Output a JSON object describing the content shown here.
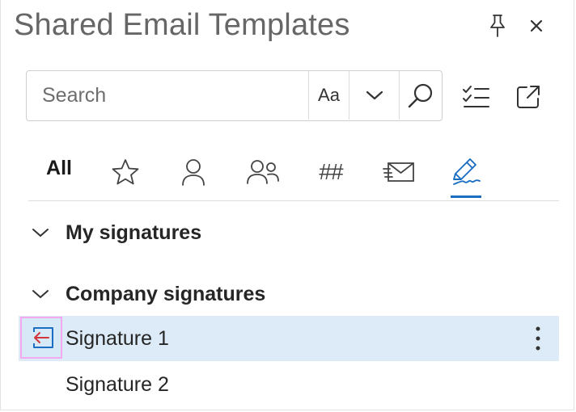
{
  "header": {
    "title": "Shared Email Templates",
    "pin_icon": "pin-icon",
    "close_icon": "close-icon"
  },
  "search": {
    "placeholder": "Search",
    "value": "",
    "match_case_label": "Aa",
    "dropdown_icon": "chevron-down-icon",
    "find_icon": "search-icon"
  },
  "toolbar": {
    "checklist_icon": "checklist-icon",
    "popout_icon": "popout-icon"
  },
  "tabs": [
    {
      "id": "all",
      "label": "All",
      "icon": "",
      "selected": false
    },
    {
      "id": "favorites",
      "label": "",
      "icon": "star-icon",
      "selected": false
    },
    {
      "id": "personal",
      "label": "",
      "icon": "person-icon",
      "selected": false
    },
    {
      "id": "team",
      "label": "",
      "icon": "people-icon",
      "selected": false
    },
    {
      "id": "macros",
      "label": "##",
      "icon": "",
      "selected": false
    },
    {
      "id": "email",
      "label": "",
      "icon": "email-icon",
      "selected": false
    },
    {
      "id": "signatures",
      "label": "",
      "icon": "signature-pen-icon",
      "selected": true
    }
  ],
  "groups": [
    {
      "label": "My signatures",
      "expanded": false,
      "items": []
    },
    {
      "label": "Company signatures",
      "expanded": true,
      "items": [
        {
          "label": "Signature 1",
          "selected": true
        },
        {
          "label": "Signature 2",
          "selected": false
        }
      ]
    }
  ],
  "colors": {
    "accent": "#1b6ec2",
    "selected_row": "#dcebf7",
    "insert_arrow": "#d1343a",
    "highlight_border": "#f2a9ef"
  }
}
